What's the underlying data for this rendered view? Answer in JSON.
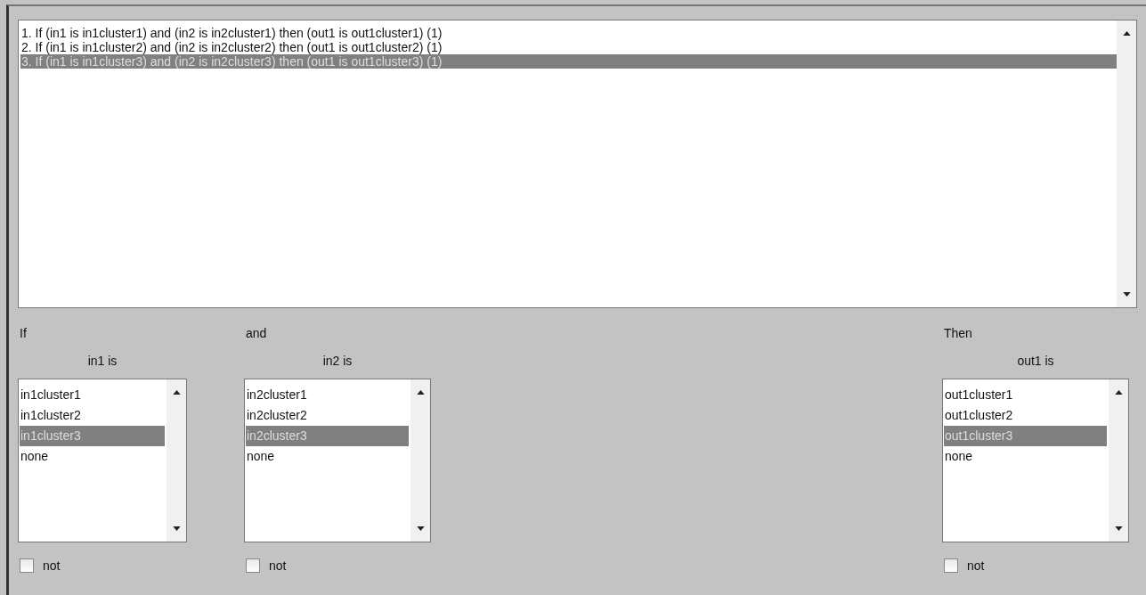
{
  "rules": [
    {
      "text": "1. If (in1 is in1cluster1) and (in2 is in2cluster1) then (out1 is out1cluster1) (1)",
      "selected": false
    },
    {
      "text": "2. If (in1 is in1cluster2) and (in2 is in2cluster2) then (out1 is out1cluster2) (1)",
      "selected": false
    },
    {
      "text": "3. If (in1 is in1cluster3) and (in2 is in2cluster3) then (out1 is out1cluster3) (1)",
      "selected": true
    }
  ],
  "variables": [
    {
      "heading": "If",
      "label": "in1 is",
      "options": [
        {
          "text": "in1cluster1",
          "selected": false
        },
        {
          "text": "in1cluster2",
          "selected": false
        },
        {
          "text": "in1cluster3",
          "selected": true
        },
        {
          "text": "none",
          "selected": false
        }
      ],
      "not": {
        "label": "not",
        "checked": false
      }
    },
    {
      "heading": "and",
      "label": "in2 is",
      "options": [
        {
          "text": "in2cluster1",
          "selected": false
        },
        {
          "text": "in2cluster2",
          "selected": false
        },
        {
          "text": "in2cluster3",
          "selected": true
        },
        {
          "text": "none",
          "selected": false
        }
      ],
      "not": {
        "label": "not",
        "checked": false
      }
    },
    {
      "heading": "Then",
      "label": "out1 is",
      "options": [
        {
          "text": "out1cluster1",
          "selected": false
        },
        {
          "text": "out1cluster2",
          "selected": false
        },
        {
          "text": "out1cluster3",
          "selected": true
        },
        {
          "text": "none",
          "selected": false
        }
      ],
      "not": {
        "label": "not",
        "checked": false
      }
    }
  ]
}
